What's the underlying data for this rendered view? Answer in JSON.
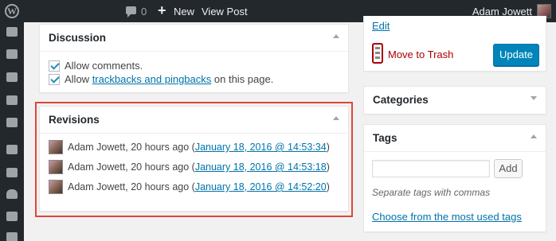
{
  "adminbar": {
    "logo": "W",
    "comment_count": "0",
    "new_label": "New",
    "view_post_label": "View Post",
    "user_name": "Adam Jowett"
  },
  "discussion": {
    "title": "Discussion",
    "allow_comments": "Allow comments.",
    "allow_prefix": "Allow ",
    "trackbacks_link": "trackbacks and pingbacks",
    "allow_suffix": " on this page."
  },
  "revisions": {
    "title": "Revisions",
    "items": [
      {
        "author": "Adam Jowett, 20 hours ago (",
        "date": "January 18, 2016 @ 14:53:34",
        "close": ")"
      },
      {
        "author": "Adam Jowett, 20 hours ago (",
        "date": "January 18, 2016 @ 14:53:18",
        "close": ")"
      },
      {
        "author": "Adam Jowett, 20 hours ago (",
        "date": "January 18, 2016 @ 14:52:20",
        "close": ")"
      }
    ]
  },
  "publish": {
    "edit_label": "Edit",
    "trash_label": "Move to Trash",
    "update_label": "Update"
  },
  "categories": {
    "title": "Categories"
  },
  "tags": {
    "title": "Tags",
    "add_label": "Add",
    "hint": "Separate tags with commas",
    "choose_link": "Choose from the most used tags"
  },
  "colors": {
    "accent": "#0085ba",
    "highlight": "#e0453a",
    "trash": "#aa0000"
  }
}
